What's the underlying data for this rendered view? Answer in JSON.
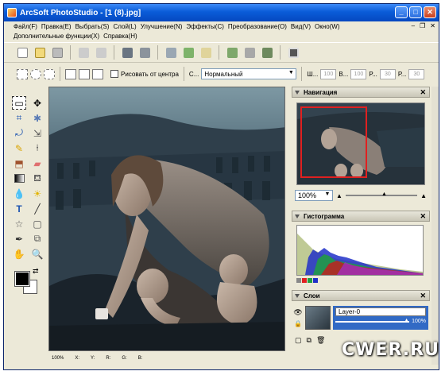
{
  "window": {
    "title": "ArcSoft PhotoStudio - [1 (8).jpg]"
  },
  "menu": {
    "row1": [
      "Файл(F)",
      "Правка(E)",
      "Выбрать(S)",
      "Слой(L)",
      "Улучшение(N)",
      "Эффекты(C)",
      "Преобразование(O)",
      "Вид(V)",
      "Окно(W)"
    ],
    "row2": [
      "Дополнительные функции(X)",
      "Справка(H)"
    ]
  },
  "options_bar": {
    "feather_label": "Рисовать от центра",
    "style_prefix": "С...",
    "blend_mode": "Нормальный",
    "w_label": "Ш...",
    "w_value": "100",
    "h_label": "В...",
    "h_value": "100",
    "r_label": "Р...",
    "r_value": "30",
    "r2_label": "Р...",
    "r2_value": "30"
  },
  "navigator": {
    "title": "Навигация",
    "zoom": "100%"
  },
  "histogram": {
    "title": "Гистограмма"
  },
  "layers": {
    "title": "Слои",
    "layer_name": "Layer-0",
    "opacity": "100%"
  },
  "status": {
    "zoom": "100%",
    "x": "X:",
    "y": "Y:",
    "r": "R:",
    "g": "G:",
    "b": "B:"
  },
  "watermark": "CWER.RU"
}
